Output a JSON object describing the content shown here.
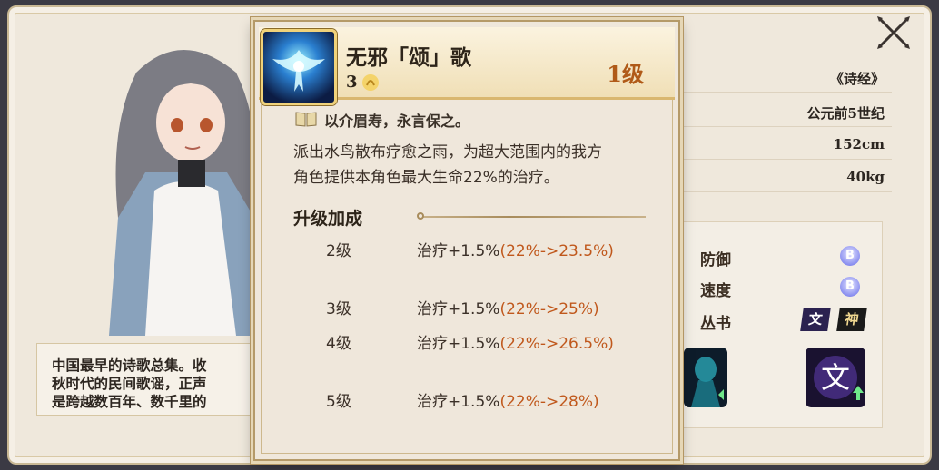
{
  "info": {
    "source": "《诗经》",
    "era": "公元前5世纪",
    "height": "152cm",
    "weight": "40kg"
  },
  "description_lines": [
    "中国最早的诗歌总集。收",
    "秋时代的民间歌谣，正声",
    "是跨越数百年、数千里的"
  ],
  "stats": [
    {
      "label": "防御",
      "grade": "B"
    },
    {
      "label": "速度",
      "grade": "B"
    },
    {
      "label": "丛书",
      "icons": [
        "文",
        "神"
      ]
    }
  ],
  "skill": {
    "name": "无邪「颂」歌",
    "cost": "3",
    "level": "1级",
    "quote": "以介眉寿，永言保之。",
    "desc_lines": [
      "派出水鸟散布疗愈之雨，为超大范围内的我方",
      "角色提供本角色最大生命22%的治疗。"
    ],
    "upgrade_title": "升级加成",
    "upgrades": [
      {
        "level": "2级",
        "effect": "治疗+1.5%",
        "change": "(22%->23.5%)"
      },
      {
        "level": "3级",
        "effect": "治疗+1.5%",
        "change": "(22%->25%)"
      },
      {
        "level": "4级",
        "effect": "治疗+1.5%",
        "change": "(22%->26.5%)"
      },
      {
        "level": "5级",
        "effect": "治疗+1.5%",
        "change": "(22%->28%)"
      }
    ]
  },
  "colors": {
    "accent": "#b05a18",
    "change_text": "#c0581c"
  }
}
